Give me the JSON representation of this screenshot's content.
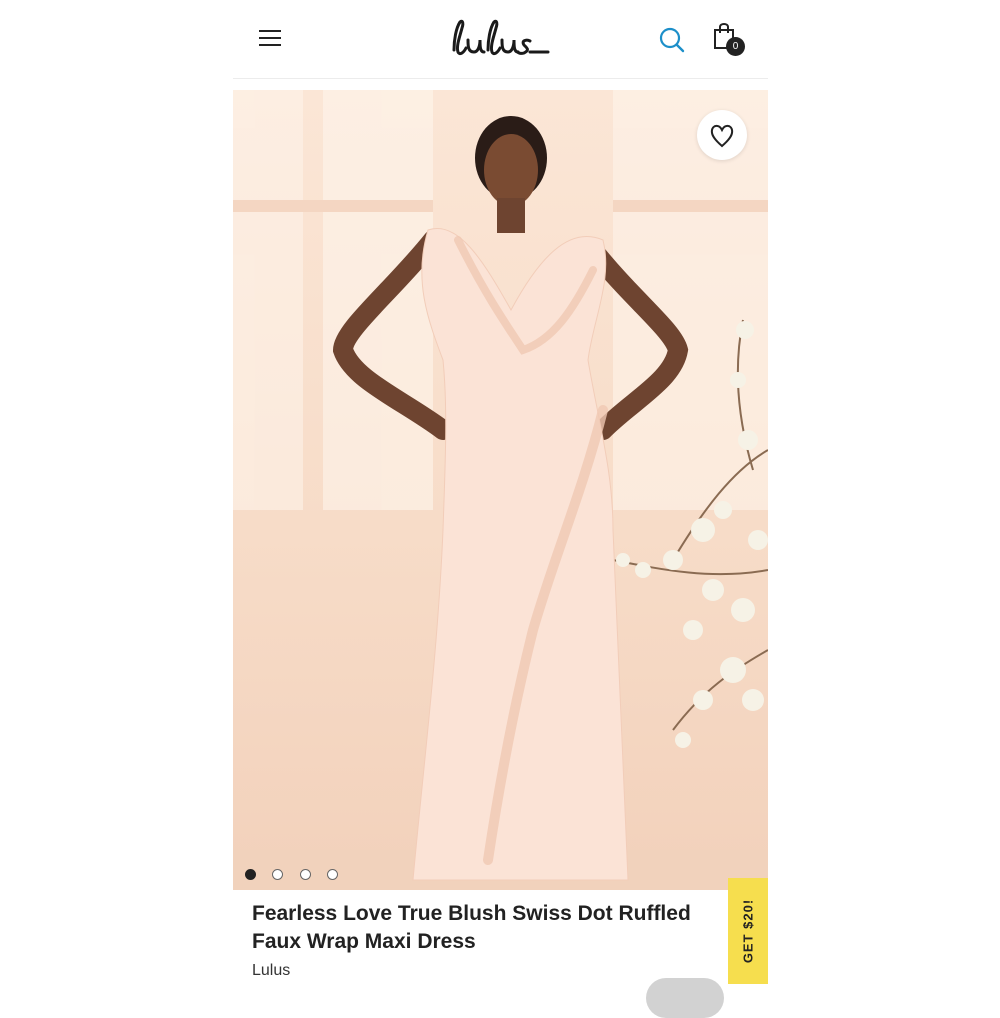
{
  "header": {
    "logo_text": "Lulus",
    "cart_count": "0",
    "icons": [
      "menu-icon",
      "search-icon",
      "shopping-bag-icon"
    ],
    "accent_color": "#1d8fc9"
  },
  "product": {
    "image_count": 4,
    "active_image": 1,
    "title": "Fearless Love True Blush Swiss Dot Ruffled Faux Wrap Maxi Dress",
    "brand": "Lulus",
    "wishlist_icon": "heart-icon"
  },
  "promo": {
    "label": "GET $20!",
    "color": "#f6de4e"
  }
}
